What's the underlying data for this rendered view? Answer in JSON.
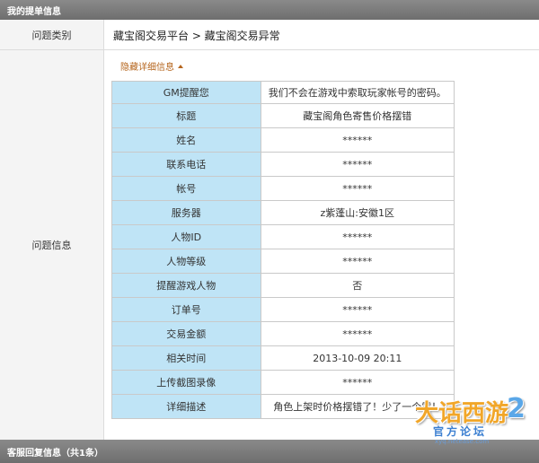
{
  "header_top": "我的提单信息",
  "issue_type": {
    "label": "问题类别",
    "value": "藏宝阁交易平台 > 藏宝阁交易异常"
  },
  "issue_info": {
    "label": "问题信息",
    "toggle_label": "隐藏详细信息",
    "rows": [
      {
        "key": "GM提醒您",
        "value": "我们不会在游戏中索取玩家帐号的密码。"
      },
      {
        "key": "标题",
        "value": "藏宝阁角色寄售价格摆错"
      },
      {
        "key": "姓名",
        "value": "******"
      },
      {
        "key": "联系电话",
        "value": "******"
      },
      {
        "key": "帐号",
        "value": "******"
      },
      {
        "key": "服务器",
        "value": "z紫蓬山:安徽1区"
      },
      {
        "key": "人物ID",
        "value": "******"
      },
      {
        "key": "人物等级",
        "value": "******"
      },
      {
        "key": "提醒游戏人物",
        "value": "否"
      },
      {
        "key": "订单号",
        "value": "******"
      },
      {
        "key": "交易金额",
        "value": "******"
      },
      {
        "key": "相关时间",
        "value": "2013-10-09 20:11"
      },
      {
        "key": "上传截图录像",
        "value": "******"
      },
      {
        "key": "详细描述",
        "value": "角色上架时价格摆错了！少了一个零！"
      }
    ]
  },
  "header_bottom": "客服回复信息（共1条）",
  "watermark": {
    "main": "大话西游",
    "num": "2",
    "sub": "官方论坛",
    "url": "xyq.netease.com"
  },
  "colors": {
    "header_bg": "#7a7a7a",
    "key_cell_bg": "#bfe4f6",
    "toggle_color": "#b5651d",
    "label_bg": "#f4f4f4"
  }
}
